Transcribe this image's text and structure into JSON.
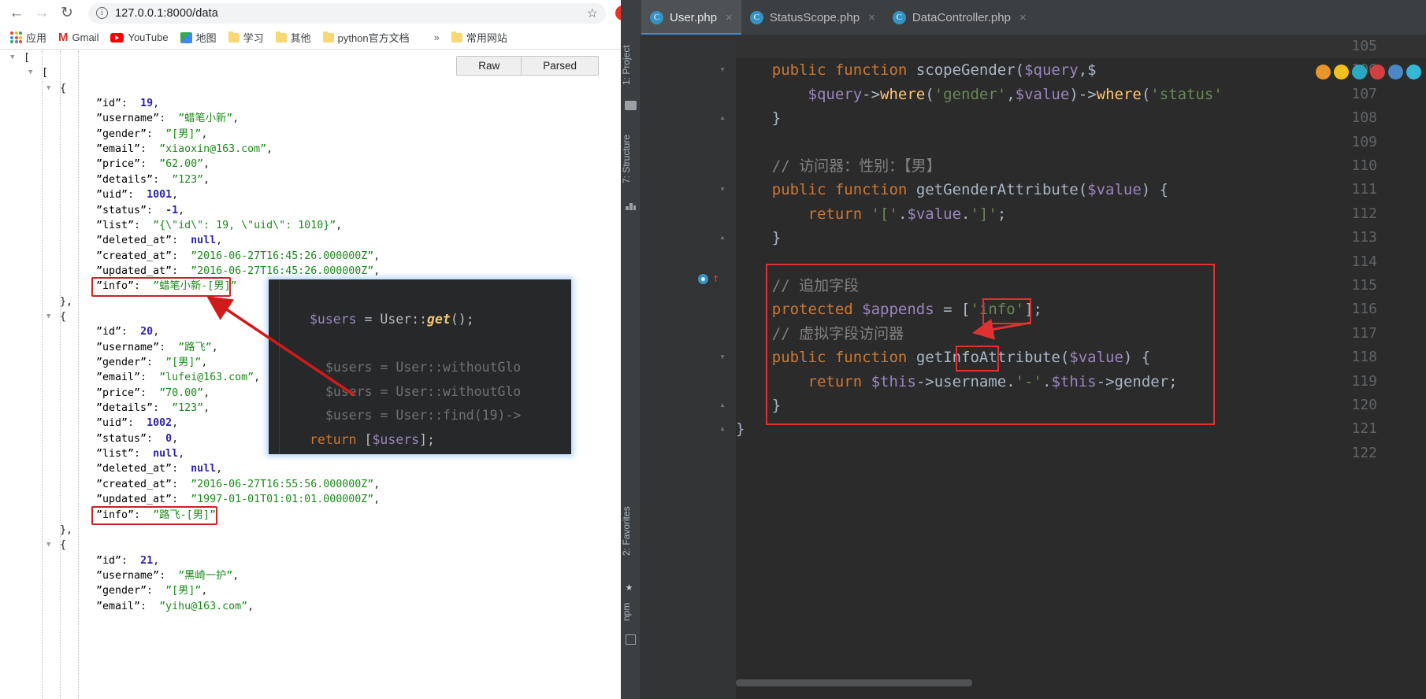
{
  "browser": {
    "nav": {
      "back": "←",
      "forward": "→",
      "reload": "↻"
    },
    "omnibox": {
      "info_icon": "i",
      "url": "127.0.0.1:8000/data",
      "star_icon": "☆"
    },
    "bookmarks": [
      {
        "label": "应用",
        "icon": "apps-grid-icon"
      },
      {
        "label": "Gmail",
        "icon": "gmail-icon"
      },
      {
        "label": "YouTube",
        "icon": "youtube-icon"
      },
      {
        "label": "地图",
        "icon": "maps-icon"
      },
      {
        "label": "学习",
        "icon": "folder-icon"
      },
      {
        "label": "其他",
        "icon": "folder-icon"
      },
      {
        "label": "python官方文档",
        "icon": "folder-icon"
      },
      {
        "label": "常用网站",
        "icon": "folder-icon"
      },
      {
        "label": "»",
        "icon": "overflow-icon"
      }
    ],
    "jsonview_tabs": [
      {
        "label": "Raw",
        "active": false
      },
      {
        "label": "Parsed",
        "active": true
      }
    ]
  },
  "json_document": {
    "lines": [
      {
        "indent": 0,
        "tri": true,
        "text": "["
      },
      {
        "indent": 1,
        "tri": true,
        "text": "["
      },
      {
        "indent": 2,
        "tri": true,
        "text": "{"
      },
      {
        "indent": 4,
        "key": "id",
        "val": "19",
        "type": "n",
        "comma": true
      },
      {
        "indent": 4,
        "key": "username",
        "val": "蜡笔小新",
        "type": "s",
        "comma": true
      },
      {
        "indent": 4,
        "key": "gender",
        "val": "[男]",
        "type": "s",
        "comma": true
      },
      {
        "indent": 4,
        "key": "email",
        "val": "xiaoxin@163.com",
        "type": "s",
        "comma": true
      },
      {
        "indent": 4,
        "key": "price",
        "val": "62.00",
        "type": "s",
        "comma": true
      },
      {
        "indent": 4,
        "key": "details",
        "val": "123",
        "type": "s",
        "comma": true
      },
      {
        "indent": 4,
        "key": "uid",
        "val": "1001",
        "type": "n",
        "comma": true
      },
      {
        "indent": 4,
        "key": "status",
        "val": "-1",
        "type": "n",
        "comma": true
      },
      {
        "indent": 4,
        "key": "list",
        "val": "{\\\"id\\\": 19, \\\"uid\\\": 1010}",
        "type": "s",
        "comma": true
      },
      {
        "indent": 4,
        "key": "deleted_at",
        "val": "null",
        "type": "nl",
        "comma": true
      },
      {
        "indent": 4,
        "key": "created_at",
        "val": "2016-06-27T16:45:26.000000Z",
        "type": "s",
        "comma": true
      },
      {
        "indent": 4,
        "key": "updated_at",
        "val": "2016-06-27T16:45:26.000000Z",
        "type": "s",
        "comma": true
      },
      {
        "indent": 4,
        "key": "info",
        "val": "蜡笔小新-[男]",
        "type": "s",
        "comma": false,
        "boxed": true
      },
      {
        "indent": 2,
        "text": "},"
      },
      {
        "indent": 2,
        "tri": true,
        "text": "{"
      },
      {
        "indent": 4,
        "key": "id",
        "val": "20",
        "type": "n",
        "comma": true
      },
      {
        "indent": 4,
        "key": "username",
        "val": "路飞",
        "type": "s",
        "comma": true
      },
      {
        "indent": 4,
        "key": "gender",
        "val": "[男]",
        "type": "s",
        "comma": true
      },
      {
        "indent": 4,
        "key": "email",
        "val": "lufei@163.com",
        "type": "s",
        "comma": true
      },
      {
        "indent": 4,
        "key": "price",
        "val": "70.00",
        "type": "s",
        "comma": true
      },
      {
        "indent": 4,
        "key": "details",
        "val": "123",
        "type": "s",
        "comma": true
      },
      {
        "indent": 4,
        "key": "uid",
        "val": "1002",
        "type": "n",
        "comma": true
      },
      {
        "indent": 4,
        "key": "status",
        "val": "0",
        "type": "n",
        "comma": true
      },
      {
        "indent": 4,
        "key": "list",
        "val": "null",
        "type": "nl",
        "comma": true
      },
      {
        "indent": 4,
        "key": "deleted_at",
        "val": "null",
        "type": "nl",
        "comma": true
      },
      {
        "indent": 4,
        "key": "created_at",
        "val": "2016-06-27T16:55:56.000000Z",
        "type": "s",
        "comma": true
      },
      {
        "indent": 4,
        "key": "updated_at",
        "val": "1997-01-01T01:01:01.000000Z",
        "type": "s",
        "comma": true
      },
      {
        "indent": 4,
        "key": "info",
        "val": "路飞-[男]",
        "type": "s",
        "comma": false,
        "boxed": true
      },
      {
        "indent": 2,
        "text": "},"
      },
      {
        "indent": 2,
        "tri": true,
        "text": "{"
      },
      {
        "indent": 4,
        "key": "id",
        "val": "21",
        "type": "n",
        "comma": true
      },
      {
        "indent": 4,
        "key": "username",
        "val": "黑崎一护",
        "type": "s",
        "comma": true
      },
      {
        "indent": 4,
        "key": "gender",
        "val": "[男]",
        "type": "s",
        "comma": true
      },
      {
        "indent": 4,
        "key": "email",
        "val": "yihu@163.com",
        "type": "s",
        "comma": true
      }
    ]
  },
  "code_overlay": {
    "lines": [
      "$users = User::get();",
      "",
      "  $users = User::withoutGlo",
      "  $users = User::withoutGlo",
      "  $users = User::find(19)->",
      "return [$users];"
    ]
  },
  "ide": {
    "tabs": [
      {
        "label": "User.php",
        "icon": "php-class-icon",
        "close": "×",
        "active": true
      },
      {
        "label": "StatusScope.php",
        "icon": "php-class-icon",
        "close": "×",
        "active": false
      },
      {
        "label": "DataController.php",
        "icon": "php-class-icon",
        "close": "×",
        "active": false
      }
    ],
    "side_labels": [
      {
        "label": "1: Project"
      },
      {
        "label": "7: Structure"
      },
      {
        "label": "2: Favorites"
      },
      {
        "label": "npm"
      }
    ],
    "editor": {
      "first_line_number": 105,
      "lines": [
        {
          "n": 105,
          "text": ""
        },
        {
          "n": 106,
          "text": "    public function scopeGender($query,$"
        },
        {
          "n": 107,
          "text": "        $query->where('gender',$value)->where('status'"
        },
        {
          "n": 108,
          "text": "    }"
        },
        {
          "n": 109,
          "text": ""
        },
        {
          "n": 110,
          "text": "    // 访问器：性别：【男】"
        },
        {
          "n": 111,
          "text": "    public function getGenderAttribute($value) {"
        },
        {
          "n": 112,
          "text": "        return '['.$value.']';"
        },
        {
          "n": 113,
          "text": "    }"
        },
        {
          "n": 114,
          "text": ""
        },
        {
          "n": 115,
          "text": "    // 追加字段"
        },
        {
          "n": 116,
          "text": "    protected $appends = ['info'];"
        },
        {
          "n": 117,
          "text": "    // 虚拟字段访问器"
        },
        {
          "n": 118,
          "text": "    public function getInfoAttribute($value) {"
        },
        {
          "n": 119,
          "text": "        return $this->username.'-'.$this->gender;"
        },
        {
          "n": 120,
          "text": "    }"
        },
        {
          "n": 121,
          "text": "}"
        },
        {
          "n": 122,
          "text": ""
        }
      ]
    }
  },
  "colors": {
    "highlight_red": "#cc2222",
    "ide_red": "#e03131",
    "editor_bg": "#2b2b2b",
    "gutter_bg": "#313335",
    "tab_active_bg": "#4e5254",
    "json_string": "#1a8a1a",
    "json_number": "#2b22a8",
    "accent_blue": "#3592c4"
  }
}
